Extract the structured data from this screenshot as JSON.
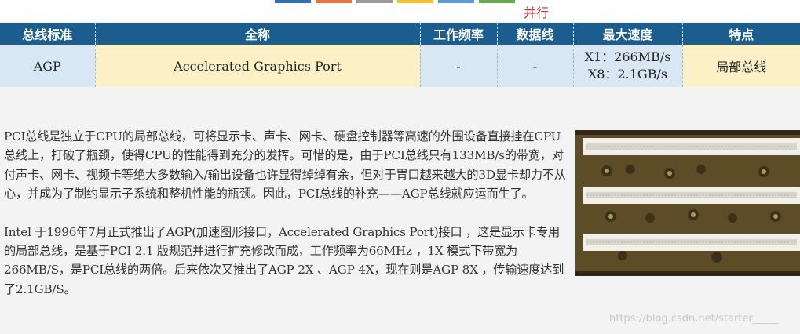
{
  "colors": {
    "header_bg": "#1b5d8f",
    "row_blue": "#d9e6f4",
    "row_yellow": "#fcf0c6",
    "note_red": "#d03030",
    "watermark": "#c8c8c8",
    "tabs": [
      "#2f6fb4",
      "#e8743b",
      "#9a9a9a",
      "#f2c22a",
      "#5b9bd5",
      "#6aa84f"
    ]
  },
  "top_note": "并行",
  "table": {
    "headers": [
      "总线标准",
      "全称",
      "工作频率",
      "数据线",
      "最大速度",
      "特点"
    ],
    "row": {
      "standard": "AGP",
      "full_name": "Accelerated Graphics Port",
      "frequency": "-",
      "data_lines": "-",
      "max_speed": [
        "X1：266MB/s",
        "X8：2.1GB/s"
      ],
      "feature": "局部总线"
    }
  },
  "paragraphs": [
    "PCI总线是独立于CPU的局部总线，可将显示卡、声卡、网卡、硬盘控制器等高速的外围设备直接挂在CPU总线上，打破了瓶颈，使得CPU的性能得到充分的发挥。可惜的是，由于PCI总线只有133MB/s的带宽，对付声卡、网卡、视频卡等绝大多数输入/输出设备也许显得绰绰有余，但对于胃口越来越大的3D显卡却力不从心，并成为了制约显示子系统和整机性能的瓶颈。因此，PCI总线的补充——AGP总线就应运而生了。",
    "Intel 于1996年7月正式推出了AGP(加速图形接口，Accelerated Graphics Port)接口 ，这是显示卡专用的局部总线，是基于PCI 2.1 版规范并进行扩充修改而成，工作频率为66MHz ，1X 模式下带宽为266MB/S，是PCI总线的两倍。后来依次又推出了AGP 2X 、AGP 4X，现在则是AGP 8X ，传输速度达到了2.1GB/S。"
  ],
  "photo": {
    "icon": "motherboard-slots-photo"
  },
  "watermark": "https://blog.csdn.net/starter_____"
}
